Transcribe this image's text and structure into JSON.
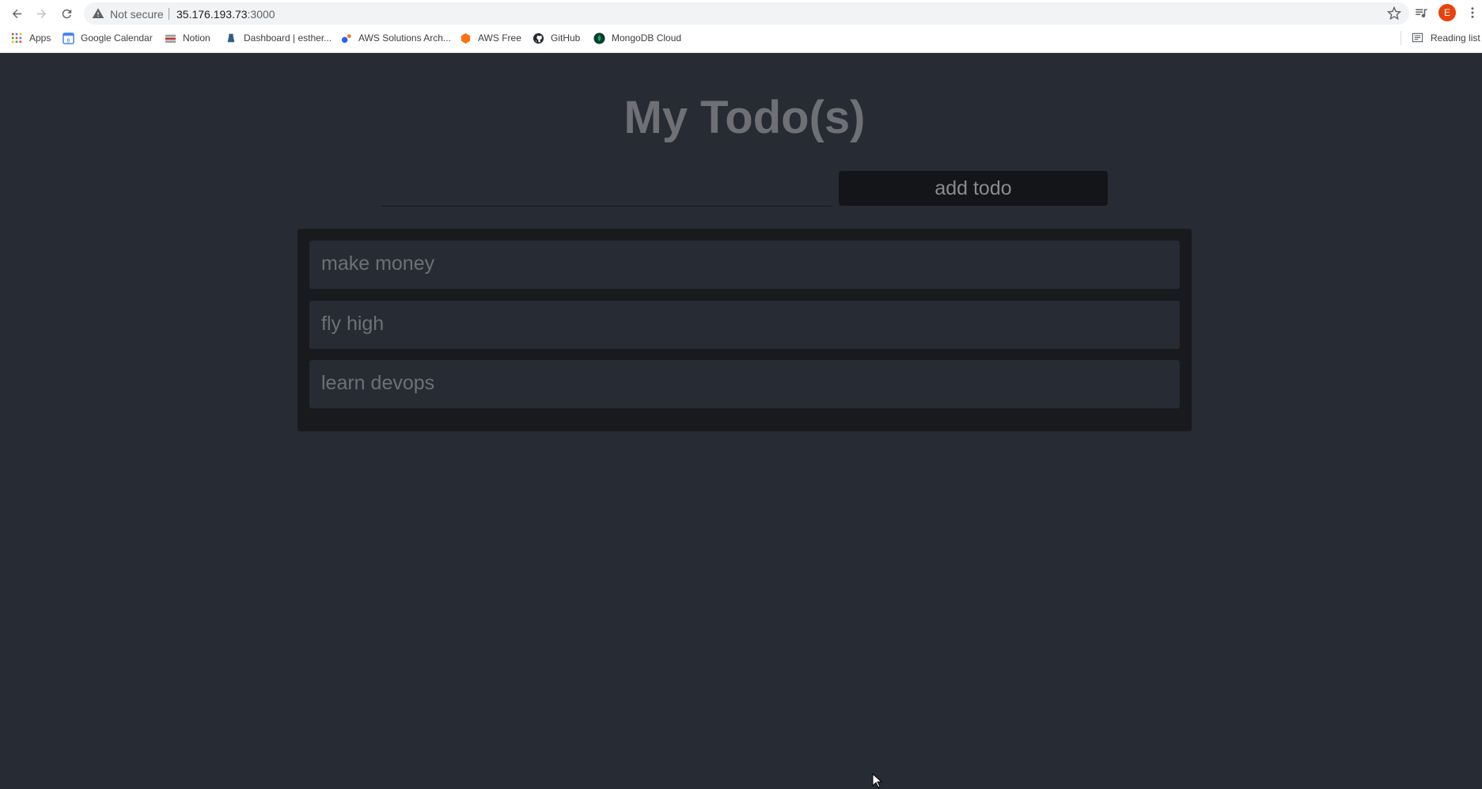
{
  "browser": {
    "security_label": "Not secure",
    "url_host": "35.176.193.73",
    "url_port": ":3000",
    "profile_initial": "E",
    "bookmarks": [
      {
        "label": "Apps",
        "icon": "apps-grid-icon"
      },
      {
        "label": "Google Calendar",
        "icon": "google-calendar-icon"
      },
      {
        "label": "Notion",
        "icon": "notion-icon"
      },
      {
        "label": "Dashboard | esther...",
        "icon": "dashboard-icon"
      },
      {
        "label": "AWS Solutions Arch...",
        "icon": "aws-solutions-icon"
      },
      {
        "label": "AWS Free",
        "icon": "aws-free-icon"
      },
      {
        "label": "GitHub",
        "icon": "github-icon"
      },
      {
        "label": "MongoDB Cloud",
        "icon": "mongodb-icon"
      }
    ],
    "reading_list_label": "Reading list"
  },
  "app": {
    "title": "My Todo(s)",
    "input_value": "",
    "add_button_label": "add todo",
    "todos": [
      {
        "text": "make money"
      },
      {
        "text": "fly high"
      },
      {
        "text": "learn devops"
      }
    ]
  },
  "colors": {
    "page_background": "#272b33",
    "panel_background": "#181a1e",
    "button_background": "#141518",
    "text_muted": "#6e7075"
  }
}
